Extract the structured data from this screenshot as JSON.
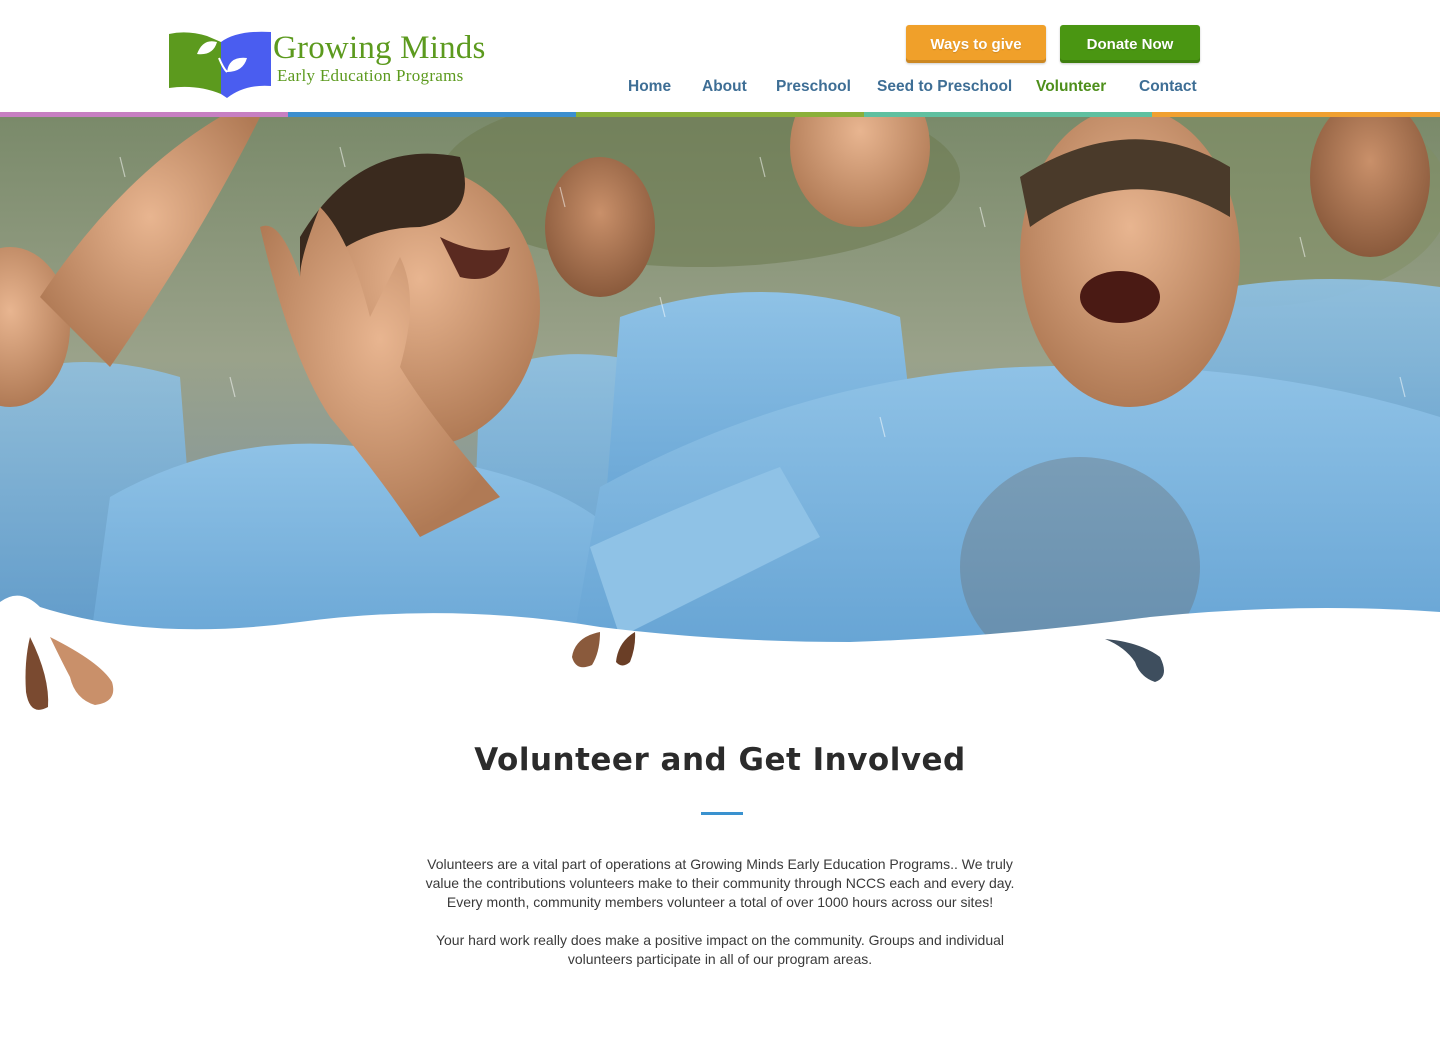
{
  "brand": {
    "title": "Growing Minds",
    "subtitle": "Early Education Programs",
    "colors": {
      "green": "#5c9a1e",
      "blue": "#4a5df0"
    }
  },
  "header": {
    "ways_to_give_label": "Ways to give",
    "donate_label": "Donate Now",
    "nav": [
      {
        "label": "Home",
        "active": false
      },
      {
        "label": "About",
        "active": false
      },
      {
        "label": "Preschool",
        "active": false
      },
      {
        "label": "Seed to Preschool",
        "active": false
      },
      {
        "label": "Volunteer",
        "active": true
      },
      {
        "label": "Contact",
        "active": false
      }
    ]
  },
  "strip_colors": [
    "#c77fc2",
    "#3c8fcf",
    "#8bb03a",
    "#5fc0a0",
    "#f0a030"
  ],
  "hero": {
    "image": "group of smiling volunteers in blue t-shirts in the rain"
  },
  "main": {
    "title": "Volunteer and Get Involved",
    "paragraph1": [
      "Volunteers are a vital part of operations at Growing Minds Early Education Programs.. We truly",
      "value the contributions volunteers make to their community through NCCS each and every day.",
      "Every month, community members volunteer a total of over 1000 hours across our sites!"
    ],
    "paragraph2": [
      "Your hard work really does make a positive impact on the community. Groups and individual",
      "volunteers participate in all of our program areas."
    ],
    "accent_color": "#3a92cf"
  }
}
